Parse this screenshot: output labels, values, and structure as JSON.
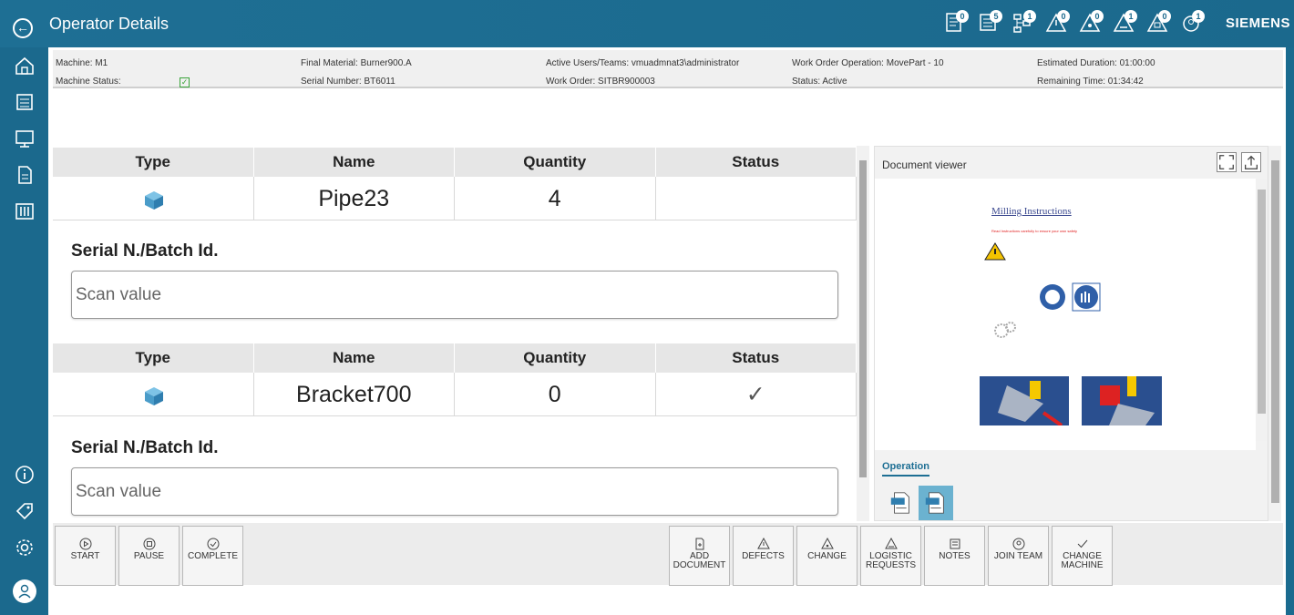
{
  "header": {
    "back_label": "←",
    "title": "Operator Details",
    "brand": "SIEMENS",
    "icons": [
      {
        "name": "documents-icon",
        "badge": "0"
      },
      {
        "name": "work-instructions-icon",
        "badge": "5"
      },
      {
        "name": "workflow-icon",
        "badge": "1"
      },
      {
        "name": "defects-alert-icon",
        "badge": "0"
      },
      {
        "name": "changes-alert-icon",
        "badge": "0"
      },
      {
        "name": "logistic-alert-icon",
        "badge": "1"
      },
      {
        "name": "notes-alert-icon",
        "badge": "0"
      },
      {
        "name": "team-alert-icon",
        "badge": "1"
      }
    ]
  },
  "info": {
    "machine": "Machine: M1",
    "machine_status": "Machine Status:",
    "machine_status_check": "✓",
    "final_material": "Final Material: Burner900.A",
    "serial_number": "Serial Number: BT6011",
    "active_users": "Active Users/Teams: vmuadmnat3\\administrator",
    "work_order": "Work Order: SITBR900003",
    "wo_operation": "Work Order Operation: MovePart - 10",
    "status": "Status: Active",
    "estimated_duration": "Estimated Duration: 01:00:00",
    "remaining_time": "Remaining Time: 01:34:42"
  },
  "materials": {
    "headers": {
      "type": "Type",
      "name": "Name",
      "quantity": "Quantity",
      "status": "Status"
    },
    "items": [
      {
        "name": "Pipe23",
        "quantity": "4",
        "status": ""
      },
      {
        "name": "Bracket700",
        "quantity": "0",
        "status": "✓"
      }
    ],
    "serial_label": "Serial N./Batch Id.",
    "scan_placeholder": "Scan value"
  },
  "docviewer": {
    "title": "Document viewer",
    "doc_title": "Milling Instructions",
    "doc_warning": "Read Instructions carefully to ensure your own safety",
    "tab": "Operation"
  },
  "toolbar": {
    "start": "START",
    "pause": "PAUSE",
    "complete": "COMPLETE",
    "add_document": "ADD DOCUMENT",
    "defects": "DEFECTS",
    "change": "CHANGE",
    "logistic_requests": "LOGISTIC REQUESTS",
    "notes": "NOTES",
    "join_team": "JOIN TEAM",
    "change_machine": "CHANGE MACHINE"
  },
  "colors": {
    "brand": "#1b698d",
    "accent": "#1e6f94",
    "status_ok": "#3aa43a"
  }
}
